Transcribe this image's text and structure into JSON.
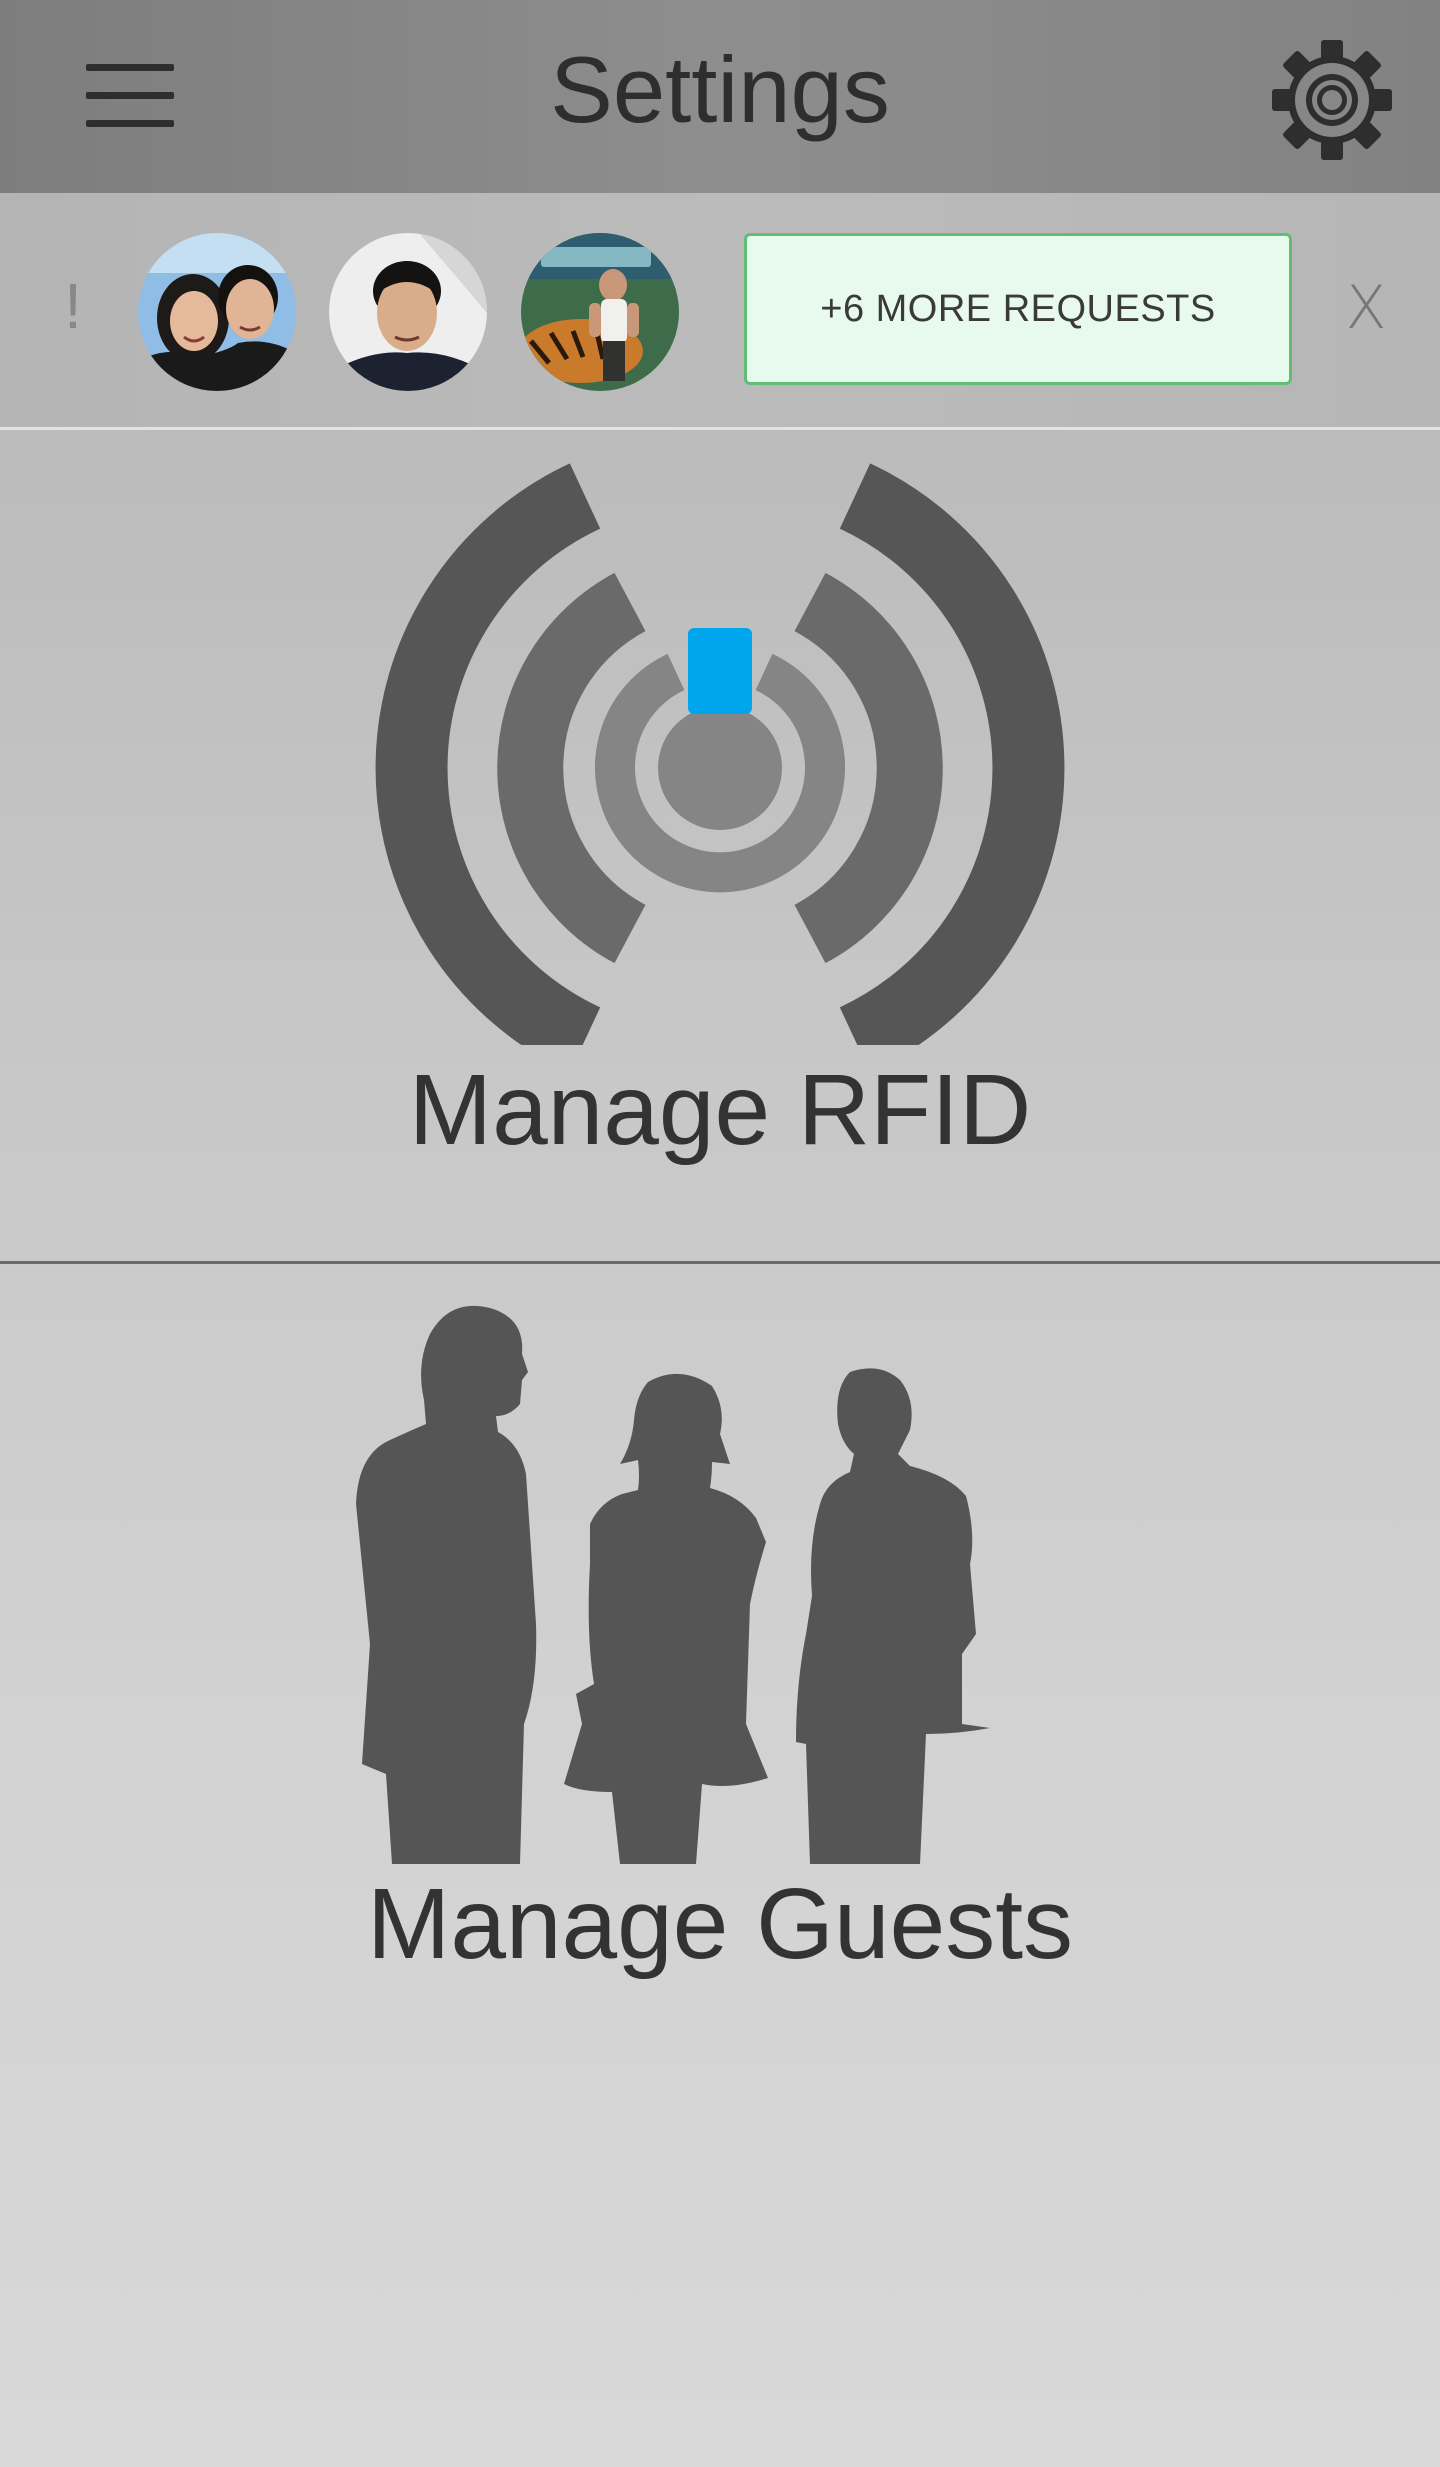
{
  "header": {
    "title": "Settings",
    "menu_icon": "hamburger-menu-icon",
    "settings_icon": "gear-icon"
  },
  "requests": {
    "alert_symbol": "!",
    "avatars": [
      {
        "icon": "avatar-couple"
      },
      {
        "icon": "avatar-man"
      },
      {
        "icon": "avatar-man-with-tiger"
      }
    ],
    "more_label": "+6 MORE REQUESTS",
    "dismiss_label": "X"
  },
  "sections": {
    "rfid": {
      "label": "Manage RFID",
      "icon": "rfid-signal-icon",
      "accent_color": "#00a6ed"
    },
    "guests": {
      "label": "Manage Guests",
      "icon": "guests-silhouette-icon"
    }
  },
  "colors": {
    "header_bg": "#868686",
    "icon_dark": "#555555",
    "more_requests_border": "#5fbf76",
    "more_requests_bg": "#e8f9ee"
  }
}
